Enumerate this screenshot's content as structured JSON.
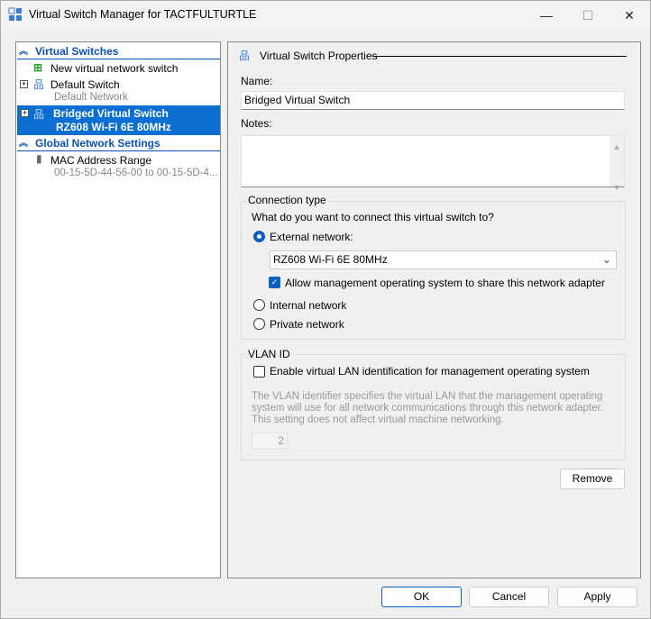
{
  "window": {
    "title": "Virtual Switch Manager for TACTFULTURTLE",
    "minimize": "—",
    "maximize": "☐",
    "close": "✕"
  },
  "tree": {
    "virtual_switches": "Virtual Switches",
    "new_switch": "New virtual network switch",
    "default_switch": "Default Switch",
    "default_switch_sub": "Default Network",
    "bridged_switch": "Bridged Virtual Switch",
    "bridged_switch_sub": "RZ608 Wi-Fi 6E 80MHz",
    "global_settings": "Global Network Settings",
    "mac_range": "MAC Address Range",
    "mac_range_sub": "00-15-5D-44-56-00 to 00-15-5D-4..."
  },
  "props": {
    "header": "Virtual Switch Properties",
    "name_label": "Name:",
    "name_value": "Bridged Virtual Switch",
    "notes_label": "Notes:",
    "notes_value": "",
    "connection_type": "Connection type",
    "question": "What do you want to connect this virtual switch to?",
    "external": "External network:",
    "adapter": "RZ608 Wi-Fi 6E 80MHz",
    "allow_mgmt": "Allow management operating system to share this network adapter",
    "internal": "Internal network",
    "private": "Private network",
    "vlan_title": "VLAN ID",
    "vlan_enable": "Enable virtual LAN identification for management operating system",
    "vlan_desc": "The VLAN identifier specifies the virtual LAN that the management operating system will use for all network communications through this network adapter. This setting does not affect virtual machine networking.",
    "vlan_value": "2",
    "remove": "Remove"
  },
  "footer": {
    "ok": "OK",
    "cancel": "Cancel",
    "apply": "Apply"
  }
}
